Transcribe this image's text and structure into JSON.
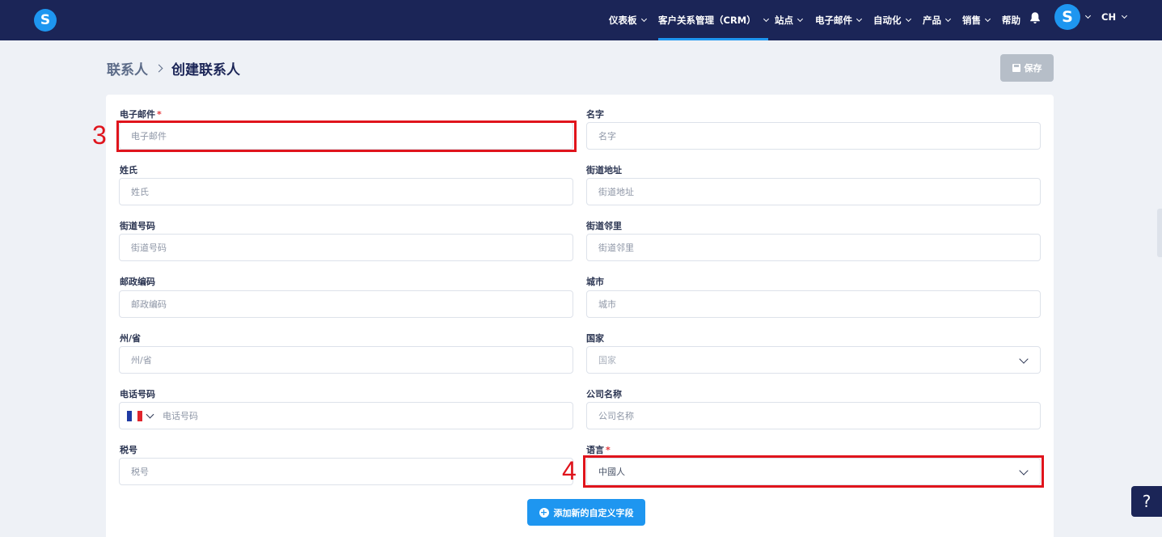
{
  "nav": {
    "items": [
      {
        "label": "仪表板",
        "has_dropdown": true,
        "active": false
      },
      {
        "label": "客户关系管理（CRM）",
        "has_dropdown": true,
        "active": true
      },
      {
        "label": "站点",
        "has_dropdown": true,
        "active": false
      },
      {
        "label": "电子邮件",
        "has_dropdown": true,
        "active": false
      },
      {
        "label": "自动化",
        "has_dropdown": true,
        "active": false
      },
      {
        "label": "产品",
        "has_dropdown": true,
        "active": false
      },
      {
        "label": "销售",
        "has_dropdown": true,
        "active": false
      },
      {
        "label": "帮助",
        "has_dropdown": false,
        "active": false
      }
    ],
    "logo_letter": "S",
    "avatar_letter": "S",
    "language": "CH",
    "notification_icon": "bell-icon"
  },
  "breadcrumb": {
    "parent": "联系人",
    "current": "创建联系人"
  },
  "toolbar": {
    "save_label": "保存",
    "save_icon": "floppy-disk-icon",
    "save_disabled": true
  },
  "form": {
    "email": {
      "label": "电子邮件",
      "required": "*",
      "placeholder": "电子邮件"
    },
    "first_name": {
      "label": "名字",
      "placeholder": "名字"
    },
    "last_name": {
      "label": "姓氏",
      "placeholder": "姓氏"
    },
    "street_address": {
      "label": "街道地址",
      "placeholder": "街道地址"
    },
    "street_number": {
      "label": "街道号码",
      "placeholder": "街道号码"
    },
    "neighborhood": {
      "label": "街道邻里",
      "placeholder": "街道邻里"
    },
    "postal_code": {
      "label": "邮政编码",
      "placeholder": "邮政编码"
    },
    "city": {
      "label": "城市",
      "placeholder": "城市"
    },
    "state": {
      "label": "州/省",
      "placeholder": "州/省"
    },
    "country": {
      "label": "国家",
      "placeholder": "国家"
    },
    "phone": {
      "label": "电话号码",
      "placeholder": "电话号码",
      "flag": "france-flag-icon"
    },
    "company": {
      "label": "公司名称",
      "placeholder": "公司名称"
    },
    "tax_id": {
      "label": "税号",
      "placeholder": "税号"
    },
    "language": {
      "label": "语言",
      "required": "*",
      "value": "中國人"
    },
    "add_custom_field_label": "添加新的自定义字段"
  },
  "annotations": {
    "marker_email": "3",
    "marker_language": "4",
    "highlight_color": "#e0141c"
  },
  "help": {
    "label": "?"
  },
  "colors": {
    "nav_bg": "#1b2557",
    "accent": "#1e96f0",
    "disabled_button": "#b6bec8"
  }
}
